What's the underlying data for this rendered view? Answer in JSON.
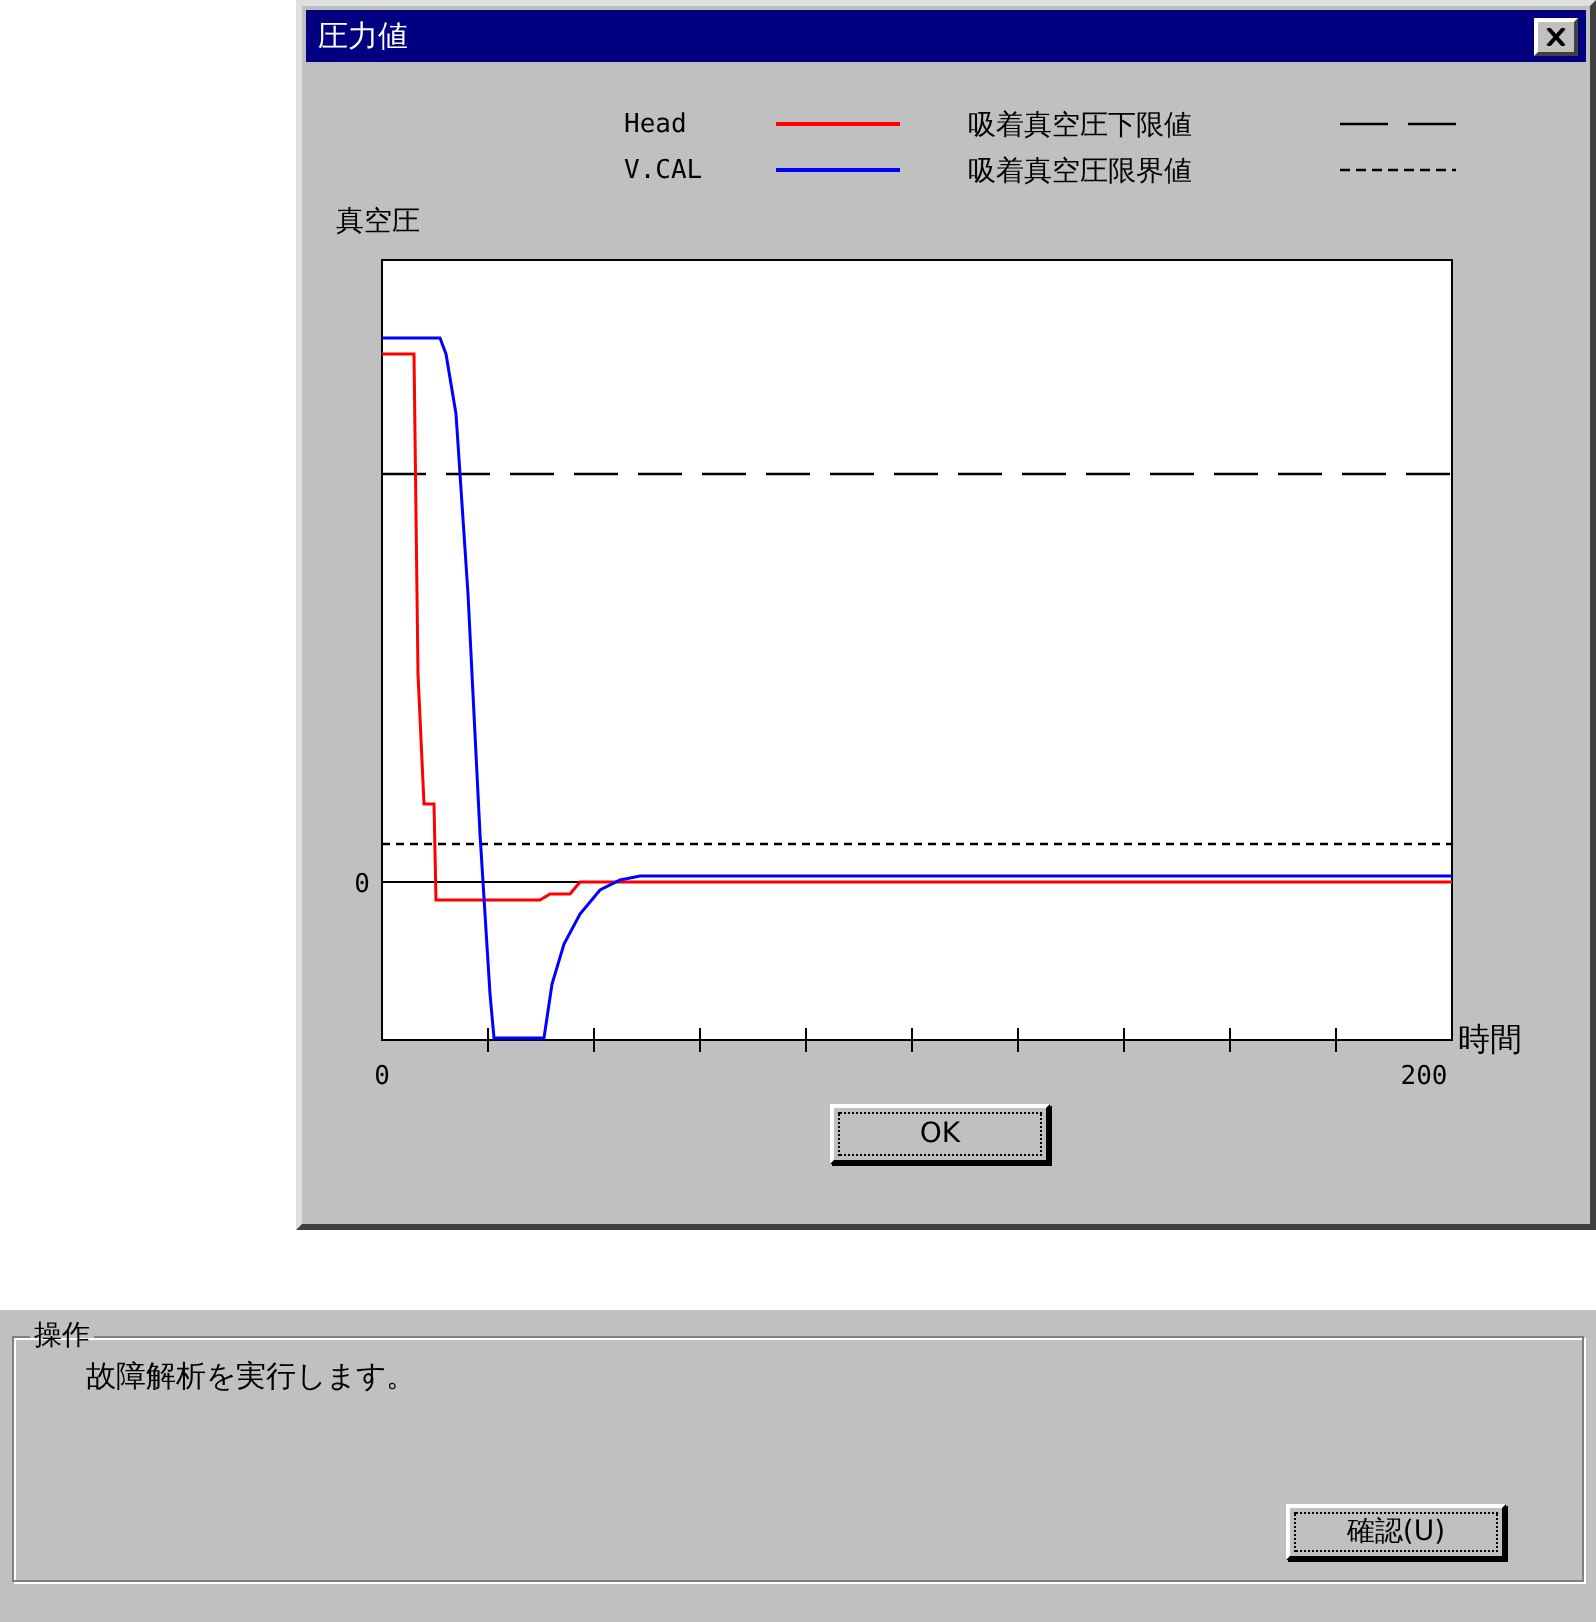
{
  "window": {
    "title": "圧力値"
  },
  "legend": {
    "series": [
      {
        "name": "Head",
        "color": "#ff0000"
      },
      {
        "name": "V.CAL",
        "color": "#0000ff"
      }
    ],
    "limits": [
      {
        "name": "吸着真空圧下限値",
        "kind": "dashed"
      },
      {
        "name": "吸着真空圧限界値",
        "kind": "dotted"
      }
    ]
  },
  "chart": {
    "ylabel": "真空圧",
    "xlabel": "時間",
    "yticks": [
      "0"
    ],
    "xticks": [
      "0",
      "200"
    ]
  },
  "ok_button": "OK",
  "operation": {
    "title": "操作",
    "message": "故障解析を実行します。",
    "button": "確認(U)"
  }
}
